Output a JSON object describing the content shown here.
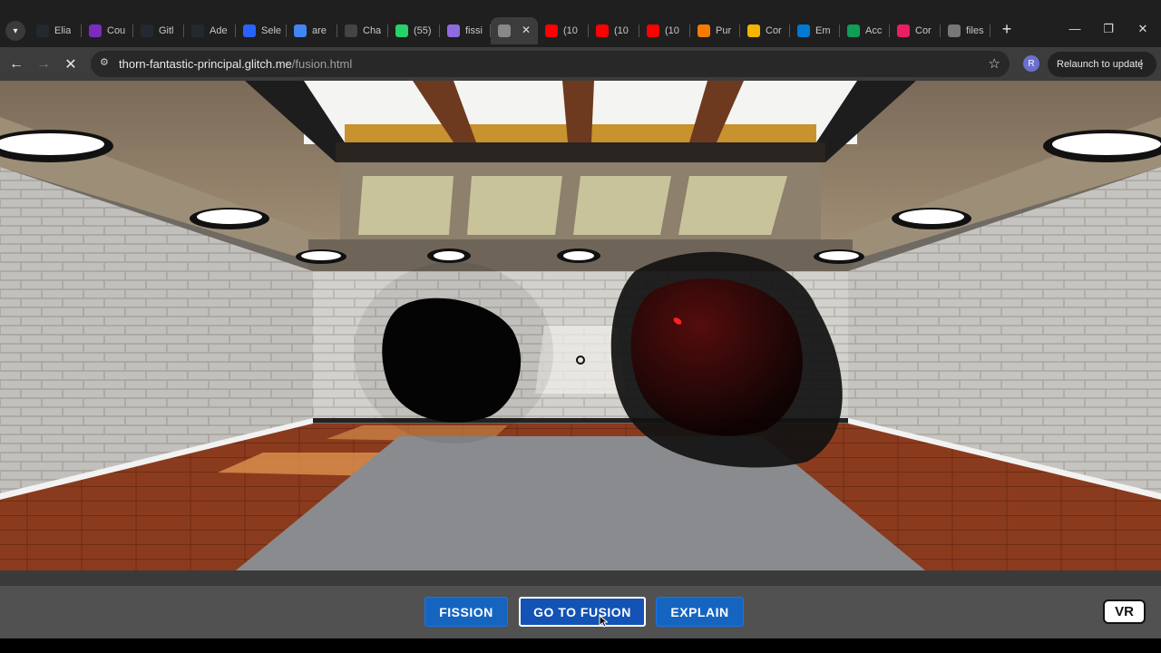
{
  "browser": {
    "tabs": [
      {
        "title": "Elia",
        "icon": "github-icon",
        "color": "#24292f"
      },
      {
        "title": "Cou",
        "icon": "course-icon",
        "color": "#7b2cbf"
      },
      {
        "title": "Gitl",
        "icon": "github-icon",
        "color": "#24292f"
      },
      {
        "title": "Ade",
        "icon": "github-icon",
        "color": "#24292f"
      },
      {
        "title": "Sele",
        "icon": "ai-icon",
        "color": "#2962ff"
      },
      {
        "title": "are",
        "icon": "google-icon",
        "color": "#4285f4"
      },
      {
        "title": "Cha",
        "icon": "chatgpt-icon",
        "color": "#444"
      },
      {
        "title": "(55)",
        "icon": "whatsapp-icon",
        "color": "#25d366"
      },
      {
        "title": "fissi",
        "icon": "gemini-icon",
        "color": "#8e6cdf"
      },
      {
        "title": "",
        "icon": "glitch-icon",
        "color": "#888",
        "active": true
      },
      {
        "title": "(10",
        "icon": "youtube-icon",
        "color": "#ff0000"
      },
      {
        "title": "(10",
        "icon": "youtube-icon",
        "color": "#ff0000"
      },
      {
        "title": "(10",
        "icon": "youtube-icon",
        "color": "#ff0000"
      },
      {
        "title": "Pur",
        "icon": "purdue-icon",
        "color": "#f57c00"
      },
      {
        "title": "Cor",
        "icon": "chart-icon",
        "color": "#f4b400"
      },
      {
        "title": "Em",
        "icon": "outlook-icon",
        "color": "#0078d4"
      },
      {
        "title": "Acc",
        "icon": "drive-icon",
        "color": "#0f9d58"
      },
      {
        "title": "Cor",
        "icon": "colorful-icon",
        "color": "#e91e63"
      },
      {
        "title": "files",
        "icon": "globe-icon",
        "color": "#777"
      }
    ],
    "url_host": "thorn-fantastic-principal.glitch.me",
    "url_path": "/fusion.html",
    "profile_initial": "R",
    "relaunch_label": "Relaunch to update"
  },
  "controls": {
    "fission_label": "FISSION",
    "fusion_label": "GO TO FUSION",
    "explain_label": "EXPLAIN",
    "vr_label": "VR"
  },
  "colors": {
    "button_blue": "#1565c0",
    "floor_wood": "#8a3a1c",
    "wall_brick": "#cfcdc8"
  }
}
